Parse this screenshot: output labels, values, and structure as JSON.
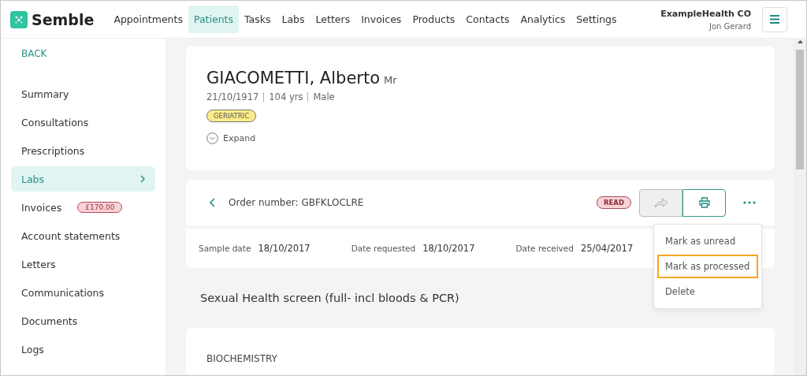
{
  "brand": {
    "name": "Semble"
  },
  "nav": [
    {
      "label": "Appointments",
      "selected": false
    },
    {
      "label": "Patients",
      "selected": true
    },
    {
      "label": "Tasks",
      "selected": false
    },
    {
      "label": "Labs",
      "selected": false
    },
    {
      "label": "Letters",
      "selected": false
    },
    {
      "label": "Invoices",
      "selected": false
    },
    {
      "label": "Products",
      "selected": false
    },
    {
      "label": "Contacts",
      "selected": false
    },
    {
      "label": "Analytics",
      "selected": false
    },
    {
      "label": "Settings",
      "selected": false
    }
  ],
  "account": {
    "organisation": "ExampleHealth CO",
    "user": "Jon Gerard"
  },
  "sidebar": {
    "back": "BACK",
    "items": [
      {
        "label": "Summary",
        "selected": false
      },
      {
        "label": "Consultations",
        "selected": false
      },
      {
        "label": "Prescriptions",
        "selected": false
      },
      {
        "label": "Labs",
        "selected": true
      },
      {
        "label": "Invoices",
        "selected": false,
        "badge": "£170.00"
      },
      {
        "label": "Account statements",
        "selected": false
      },
      {
        "label": "Letters",
        "selected": false
      },
      {
        "label": "Communications",
        "selected": false
      },
      {
        "label": "Documents",
        "selected": false
      },
      {
        "label": "Logs",
        "selected": false
      }
    ]
  },
  "patient": {
    "name": "GIACOMETTI, Alberto",
    "title": "Mr",
    "dob": "21/10/1917",
    "age": "104 yrs",
    "sex": "Male",
    "tag": "GERIATRIC",
    "expand": "Expand"
  },
  "order": {
    "number": "Order number: GBFKLOCLRE",
    "status": "READ",
    "dates": [
      {
        "label": "Sample date",
        "value": "18/10/2017"
      },
      {
        "label": "Date requested",
        "value": "18/10/2017"
      },
      {
        "label": "Date received",
        "value": "25/04/2017"
      }
    ],
    "menu": [
      {
        "label": "Mark as unread",
        "selected": false
      },
      {
        "label": "Mark as processed",
        "selected": true
      },
      {
        "label": "Delete",
        "selected": false
      }
    ]
  },
  "test_name": "Sexual Health screen (full- incl bloods & PCR)",
  "section": "BIOCHEMISTRY"
}
